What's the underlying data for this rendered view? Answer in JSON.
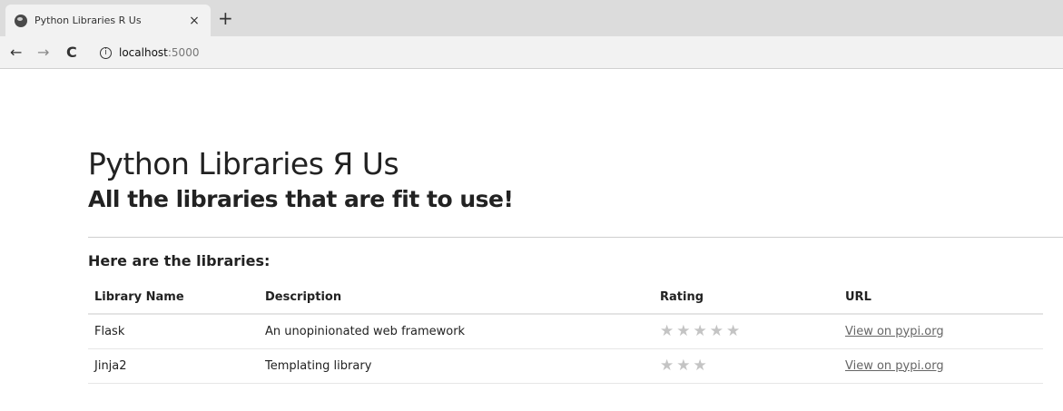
{
  "browser": {
    "tab_title": "Python Libraries R Us",
    "tab_close": "×",
    "new_tab": "+",
    "back": "←",
    "forward": "→",
    "reload": "C",
    "url_host": "localhost",
    "url_port": ":5000"
  },
  "page": {
    "title": "Python Libraries Я Us",
    "subtitle": "All the libraries that are fit to use!",
    "section_heading": "Here are the libraries:"
  },
  "table": {
    "headers": [
      "Library Name",
      "Description",
      "Rating",
      "URL"
    ],
    "rows": [
      {
        "name": "Flask",
        "description": "An unopinionated web framework",
        "rating": 5,
        "url_text": "View on pypi.org"
      },
      {
        "name": "Jinja2",
        "description": "Templating library",
        "rating": 3,
        "url_text": "View on pypi.org"
      }
    ]
  },
  "colors": {
    "star": "#c4c4c4",
    "link": "#666666",
    "tabstrip": "#dcdcdc"
  }
}
